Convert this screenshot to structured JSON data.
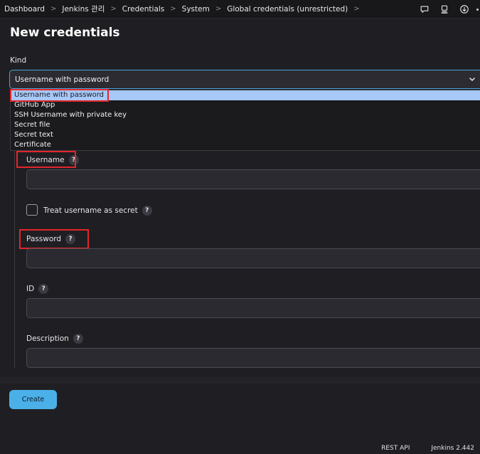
{
  "breadcrumb": [
    "Dashboard",
    "Jenkins 관리",
    "Credentials",
    "System",
    "Global credentials (unrestricted)"
  ],
  "page": {
    "title": "New credentials"
  },
  "kind": {
    "label": "Kind",
    "selected": "Username with password",
    "options": [
      "Username with password",
      "GitHub App",
      "SSH Username with private key",
      "Secret file",
      "Secret text",
      "Certificate"
    ]
  },
  "fields": {
    "username_label": "Username",
    "treat_secret_label": "Treat username as secret",
    "password_label": "Password",
    "id_label": "ID",
    "description_label": "Description",
    "help_glyph": "?"
  },
  "actions": {
    "create_label": "Create"
  },
  "footer": {
    "rest_api": "REST API",
    "version": "Jenkins 2.442"
  },
  "colors": {
    "accent": "#4bb0e8",
    "highlight_red": "#e2262b",
    "selected_option_bg": "#a8c8f8"
  },
  "icons": {
    "top": [
      "notifications-icon",
      "computer-icon",
      "download-icon"
    ]
  }
}
